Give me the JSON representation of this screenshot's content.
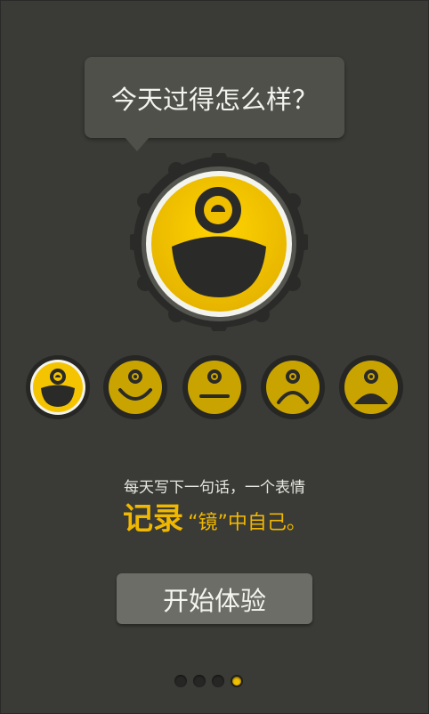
{
  "prompt": {
    "question": "今天过得怎么样？"
  },
  "moods": [
    {
      "name": "very-happy",
      "selected": true
    },
    {
      "name": "happy",
      "selected": false
    },
    {
      "name": "neutral",
      "selected": false
    },
    {
      "name": "sad",
      "selected": false
    },
    {
      "name": "very-sad",
      "selected": false
    }
  ],
  "copy": {
    "tagline": "每天写下一句话，一个表情",
    "slogan_main": "记录",
    "slogan_rest": "“镜”中自己。"
  },
  "start_button": {
    "label": "开始体验"
  },
  "pager": {
    "total": 4,
    "active": 4
  },
  "colors": {
    "accent": "#f0c000",
    "muted_face": "#c9a400",
    "background": "#3a3a36"
  }
}
